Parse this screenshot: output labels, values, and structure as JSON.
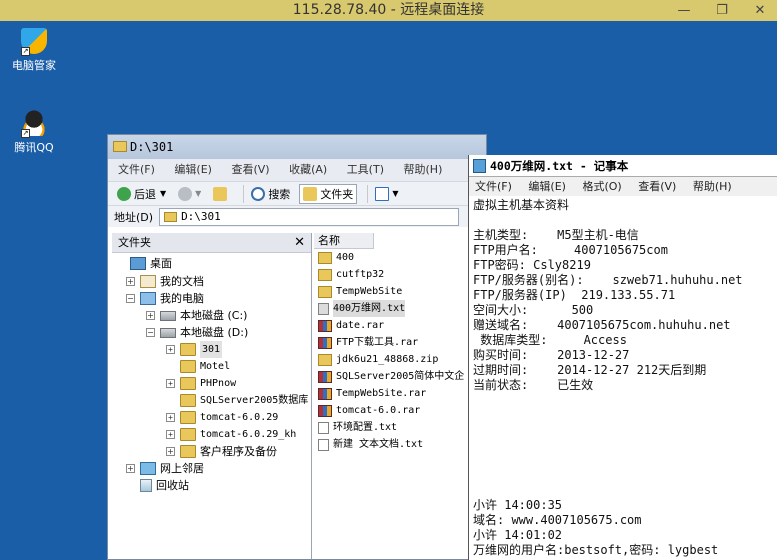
{
  "rdp": {
    "title": "115.28.78.40 - 远程桌面连接",
    "controls": [
      "—",
      "❐",
      "✕"
    ]
  },
  "desktop": {
    "icons": [
      {
        "label": "电脑管家",
        "icon": "tencent-pc-manager-icon"
      },
      {
        "label": "腾讯QQ",
        "icon": "qq-penguin-icon"
      }
    ]
  },
  "explorer": {
    "title": "D:\\301",
    "menu": [
      "文件(F)",
      "编辑(E)",
      "查看(V)",
      "收藏(A)",
      "工具(T)",
      "帮助(H)"
    ],
    "toolbar": {
      "back": "后退",
      "search": "搜索",
      "folders": "文件夹"
    },
    "address_label": "地址(D)",
    "address_value": "D:\\301",
    "tree_title": "文件夹",
    "tree": [
      {
        "label": "桌面",
        "exp": "",
        "icon": "desk"
      },
      {
        "label": "我的文档",
        "exp": "+",
        "icon": "docs"
      },
      {
        "label": "我的电脑",
        "exp": "−",
        "icon": "pc"
      },
      {
        "label": "本地磁盘 (C:)",
        "exp": "+",
        "icon": "drive"
      },
      {
        "label": "本地磁盘 (D:)",
        "exp": "−",
        "icon": "drive"
      },
      {
        "label": "301",
        "exp": "+",
        "icon": "folder"
      },
      {
        "label": "Motel",
        "exp": "",
        "icon": "folder"
      },
      {
        "label": "PHPnow",
        "exp": "+",
        "icon": "folder"
      },
      {
        "label": "SQLServer2005数据库",
        "exp": "",
        "icon": "folder"
      },
      {
        "label": "tomcat-6.0.29",
        "exp": "+",
        "icon": "folder"
      },
      {
        "label": "tomcat-6.0.29_kh",
        "exp": "+",
        "icon": "folder"
      },
      {
        "label": "客户程序及备份",
        "exp": "+",
        "icon": "folder"
      },
      {
        "label": "网上邻居",
        "exp": "+",
        "icon": "net"
      },
      {
        "label": "回收站",
        "exp": "",
        "icon": "bin"
      }
    ],
    "files_header": "名称",
    "files": [
      {
        "name": "400",
        "type": "folder"
      },
      {
        "name": "cutftp32",
        "type": "folder"
      },
      {
        "name": "TempWebSite",
        "type": "folder"
      },
      {
        "name": "400万维网.txt",
        "type": "txt"
      },
      {
        "name": "date.rar",
        "type": "rar"
      },
      {
        "name": "FTP下载工具.rar",
        "type": "rar"
      },
      {
        "name": "jdk6u21_48868.zip",
        "type": "zip"
      },
      {
        "name": "SQLServer2005简体中文企",
        "type": "rar"
      },
      {
        "name": "TempWebSite.rar",
        "type": "rar"
      },
      {
        "name": "tomcat-6.0.rar",
        "type": "rar"
      },
      {
        "name": "环境配置.txt",
        "type": "txt"
      },
      {
        "name": "新建 文本文档.txt",
        "type": "txt"
      }
    ]
  },
  "notepad": {
    "title": "400万维网.txt - 记事本",
    "menu": [
      "文件(F)",
      "编辑(E)",
      "格式(O)",
      "查看(V)",
      "帮助(H)"
    ],
    "lines": [
      "虚拟主机基本资料",
      "",
      "主机类型:    M5型主机-电信",
      "FTP用户名:     4007105675com",
      "FTP密码: Csly8219",
      "FTP/服务器(别名):    szweb71.huhuhu.net",
      "FTP/服务器(IP)  219.133.55.71",
      "空间大小:      500",
      "赠送域名:    4007105675com.huhuhu.net",
      " 数据库类型:     Access",
      "购买时间:    2013-12-27",
      "过期时间:    2014-12-27 212天后到期",
      "当前状态:    已生效",
      "",
      "",
      "",
      "",
      "",
      "",
      "",
      "小许 14:00:35",
      "域名: www.4007105675.com",
      "小许 14:01:02",
      "万维网的用户名:bestsoft,密码: lygbest"
    ]
  }
}
